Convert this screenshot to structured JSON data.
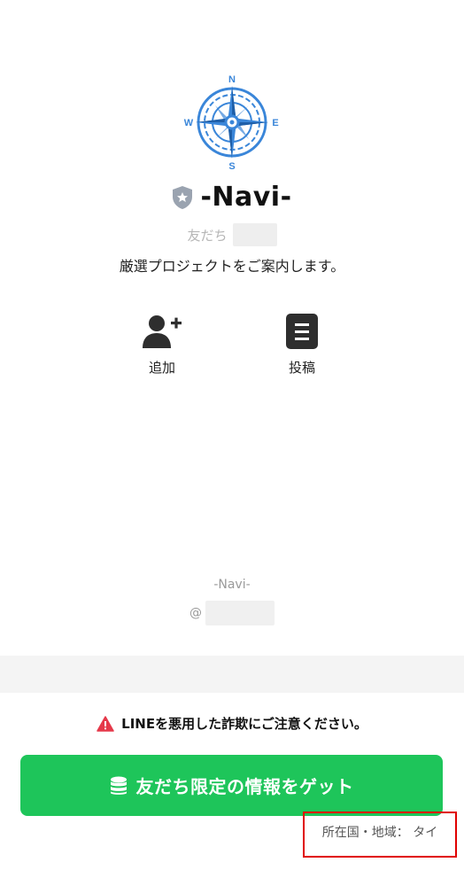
{
  "profile": {
    "name": "-Navi-",
    "friends_label": "友だち",
    "status_message": "厳選プロジェクトをご案内します。",
    "avatar_letters": {
      "n": "N",
      "e": "E",
      "s": "S",
      "w": "W"
    }
  },
  "actions": [
    {
      "label": "追加",
      "icon": "add-friend-icon"
    },
    {
      "label": "投稿",
      "icon": "post-icon"
    }
  ],
  "footer": {
    "name": "-Navi-",
    "id_prefix": "@"
  },
  "warning": {
    "text": "LINEを悪用した詐欺にご注意ください。",
    "icon": "warning-triangle-icon",
    "color": "#e5394a"
  },
  "cta": {
    "label": "友だち限定の情報をゲット",
    "icon": "coins-icon",
    "color": "#1ec55a"
  },
  "region": {
    "text": "所在国・地域： タイ"
  },
  "colors": {
    "accent_blue": "#3a86d9",
    "highlight_box": "#e00000"
  }
}
